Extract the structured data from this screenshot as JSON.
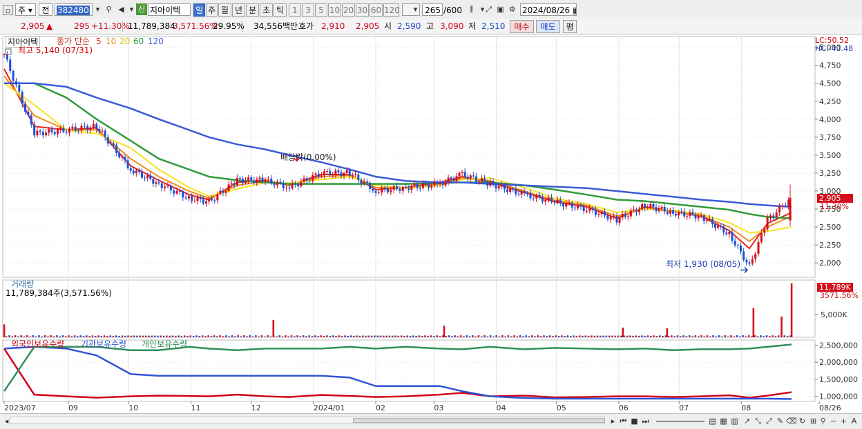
{
  "toolbar": {
    "market_label": "주",
    "prev_label": "전",
    "code": "382480",
    "new_badge": "신",
    "stock_name": "지아이텍",
    "period_tabs": [
      "일",
      "주",
      "월",
      "년",
      "분",
      "초",
      "틱"
    ],
    "interval_options": [
      "1",
      "3",
      "5",
      "10",
      "20",
      "30",
      "60",
      "120"
    ],
    "count": "265",
    "count_max": "/600",
    "date": "2024/08/26"
  },
  "quote": {
    "price": "2,905",
    "arrow": "▲",
    "change": "295",
    "change_pct": "+11.30%",
    "volume": "11,789,384",
    "vol_ratio": "3,571.56%",
    "turnover": "29.95%",
    "amount": "34,556백만",
    "bid_label": "호가",
    "ask": "2,910",
    "bid": "2,905",
    "open_label": "시",
    "open": "2,590",
    "high_label": "고",
    "high": "3,090",
    "low_label": "저",
    "low": "2,510",
    "buy_label": "매수",
    "sell_label": "매도",
    "eval_label": "평"
  },
  "legend": {
    "stock_name": "지아이텍",
    "ma_title": "종가 단순",
    "ma_periods": [
      "5",
      "10",
      "20",
      "60",
      "120"
    ],
    "ma_colors": [
      "#e8241b",
      "#f08c1c",
      "#f5e31f",
      "#2f9b3a",
      "#3a5bd9"
    ],
    "high_note": "최고 5,140 (07/31)",
    "low_note": "최저 1,930 (08/05)",
    "dividend_note": "배당락(0.00%)",
    "lc": "LC:50.52",
    "hc": "HC:-43.48",
    "price_tag": "2,905",
    "pct_tag": "11.30%"
  },
  "volume_panel": {
    "title": "거래량",
    "value": "11,789,384주(3,571.56%)",
    "tag": "11,789K",
    "tag_pct": "3571.56%",
    "tick": "5,000K"
  },
  "holding_panel": {
    "titles": [
      "외국인보유수량",
      "기관보유수량",
      "개인보유수량"
    ],
    "colors": [
      "#d0021b",
      "#2f55d4",
      "#2f8f5a"
    ]
  },
  "chart_data": {
    "type": "line",
    "title": "지아이텍",
    "x_months": [
      "2023/07",
      "09",
      "10",
      "11",
      "12",
      "2024/01",
      "02",
      "03",
      "04",
      "05",
      "06",
      "07",
      "08",
      "08/26"
    ],
    "price_axis": {
      "ylim": [
        1800,
        5150
      ],
      "ticks": [
        2000,
        2250,
        2500,
        2750,
        3000,
        3250,
        3500,
        3750,
        4000,
        4250,
        4500,
        4750,
        5000
      ],
      "tick_labels": [
        "2,000",
        "2,250",
        "2,500",
        "2,750",
        "3,000",
        "3,250",
        "3,500",
        "3,750",
        "4,000",
        "4,250",
        "4,500",
        "4,750",
        "5,000"
      ]
    },
    "close_series": {
      "x": [
        "2023/07/31",
        "2023/08/15",
        "2023/08/31",
        "2023/09/15",
        "2023/10/02",
        "2023/10/16",
        "2023/10/31",
        "2023/11/10",
        "2023/11/24",
        "2023/12/08",
        "2023/12/20",
        "2024/01/05",
        "2024/01/19",
        "2024/02/01",
        "2024/02/16",
        "2024/03/04",
        "2024/03/15",
        "2024/03/29",
        "2024/04/15",
        "2024/04/30",
        "2024/05/16",
        "2024/05/31",
        "2024/06/14",
        "2024/06/28",
        "2024/07/12",
        "2024/07/26",
        "2024/08/05",
        "2024/08/14",
        "2024/08/26"
      ],
      "values": [
        4900,
        3800,
        3850,
        3900,
        3300,
        3100,
        2900,
        2850,
        3150,
        3150,
        3050,
        3250,
        3250,
        3000,
        3050,
        3100,
        3230,
        3100,
        2950,
        2850,
        2750,
        2600,
        2800,
        2700,
        2650,
        2400,
        1950,
        2600,
        2905
      ]
    },
    "ma_series": [
      {
        "name": "5",
        "values": [
          4700,
          3900,
          3850,
          3880,
          3350,
          3150,
          2950,
          2880,
          3120,
          3150,
          3080,
          3230,
          3230,
          3020,
          3050,
          3120,
          3200,
          3120,
          2980,
          2850,
          2780,
          2620,
          2780,
          2720,
          2650,
          2450,
          2200,
          2550,
          2700
        ]
      },
      {
        "name": "10",
        "values": [
          4600,
          4050,
          3850,
          3850,
          3450,
          3200,
          3000,
          2900,
          3080,
          3140,
          3090,
          3200,
          3220,
          3050,
          3040,
          3100,
          3180,
          3140,
          3000,
          2870,
          2800,
          2650,
          2760,
          2720,
          2660,
          2500,
          2300,
          2500,
          2650
        ]
      },
      {
        "name": "20",
        "values": [
          4500,
          4200,
          3850,
          3800,
          3600,
          3300,
          3050,
          2930,
          3030,
          3120,
          3110,
          3160,
          3200,
          3080,
          3040,
          3080,
          3160,
          3180,
          3050,
          2900,
          2820,
          2700,
          2750,
          2730,
          2680,
          2560,
          2420,
          2440,
          2500
        ]
      },
      {
        "name": "60",
        "values": [
          4500,
          4500,
          4300,
          4000,
          3700,
          3450,
          3300,
          3200,
          3150,
          3120,
          3100,
          3100,
          3100,
          3100,
          3100,
          3110,
          3120,
          3120,
          3080,
          3020,
          2950,
          2880,
          2860,
          2820,
          2780,
          2740,
          2680,
          2640,
          2620
        ]
      },
      {
        "name": "120",
        "values": [
          4500,
          4500,
          4450,
          4300,
          4150,
          4000,
          3850,
          3750,
          3650,
          3580,
          3500,
          3400,
          3300,
          3200,
          3140,
          3120,
          3120,
          3100,
          3080,
          3060,
          3040,
          3000,
          2960,
          2920,
          2880,
          2850,
          2820,
          2800,
          2780
        ]
      }
    ],
    "volume_spikes": [
      {
        "x": "2023/07/31",
        "value": 2800
      },
      {
        "x": "2023/12/12",
        "value": 3800
      },
      {
        "x": "2024/03/06",
        "value": 2500
      },
      {
        "x": "2024/06/03",
        "value": 2100
      },
      {
        "x": "2024/06/25",
        "value": 2000
      },
      {
        "x": "2024/08/07",
        "value": 6400
      },
      {
        "x": "2024/08/21",
        "value": 4500
      },
      {
        "x": "2024/08/26",
        "value": 11789
      }
    ],
    "holding_axis": {
      "ticks": [
        1000000,
        1500000,
        2000000,
        2500000
      ],
      "tick_labels": [
        "1,000,000",
        "1,500,000",
        "2,000,000",
        "2,500,000"
      ]
    },
    "holding_series": [
      {
        "name": "외국인보유수량",
        "values": [
          2400000,
          1050000,
          1000000,
          960000,
          1000000,
          1020000,
          1010000,
          1000000,
          1050000,
          1000000,
          980000,
          1040000,
          1010000,
          980000,
          1000000,
          1050000,
          1100000,
          1000000,
          1020000,
          970000,
          980000,
          1000000,
          1000000,
          980000,
          1000000,
          1030000,
          960000,
          1020000,
          1120000
        ]
      },
      {
        "name": "기관보유수량",
        "values": [
          2400000,
          2450000,
          2400000,
          2200000,
          1650000,
          1600000,
          1600000,
          1600000,
          1600000,
          1600000,
          1600000,
          1600000,
          1550000,
          1300000,
          1300000,
          1300000,
          1150000,
          1000000,
          950000,
          930000,
          930000,
          930000,
          930000,
          930000,
          930000,
          930000,
          930000,
          930000,
          920000
        ]
      },
      {
        "name": "개인보유수량",
        "values": [
          1150000,
          2450000,
          2450000,
          2450000,
          2350000,
          2350000,
          2450000,
          2400000,
          2350000,
          2400000,
          2400000,
          2400000,
          2450000,
          2400000,
          2450000,
          2400000,
          2380000,
          2450000,
          2380000,
          2420000,
          2400000,
          2380000,
          2400000,
          2350000,
          2380000,
          2380000,
          2400000,
          2450000,
          2520000
        ]
      }
    ]
  }
}
